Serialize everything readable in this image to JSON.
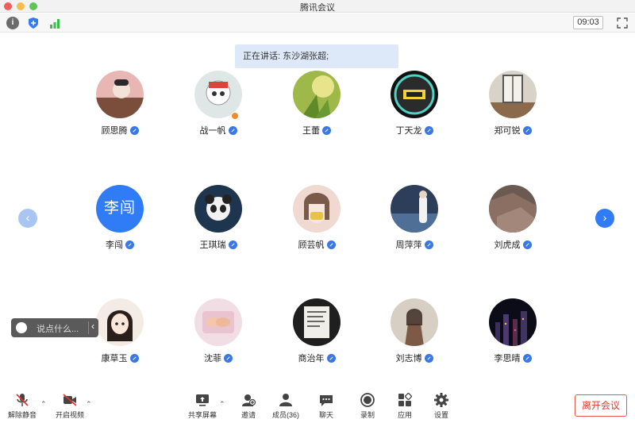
{
  "window": {
    "title": "腾讯会议"
  },
  "toolbar": {
    "time": "09:03"
  },
  "banner": {
    "speaking_text": "正在讲话: 东沙湖张超;"
  },
  "participants": [
    {
      "name": "顾思腾"
    },
    {
      "name": "战一帆",
      "host": true
    },
    {
      "name": "王蕾"
    },
    {
      "name": "丁天龙"
    },
    {
      "name": "郑可锐"
    },
    {
      "name": "李闯",
      "avatar_text": "李闯"
    },
    {
      "name": "王琪瑞"
    },
    {
      "name": "顾芸帆"
    },
    {
      "name": "周萍萍"
    },
    {
      "name": "刘虎成"
    },
    {
      "name": "康草玉"
    },
    {
      "name": "沈菲"
    },
    {
      "name": "商治年"
    },
    {
      "name": "刘志博"
    },
    {
      "name": "李思晴"
    }
  ],
  "chat": {
    "placeholder": "说点什么..."
  },
  "bottom": {
    "mute": "解除静音",
    "video": "开启视频",
    "share": "共享屏幕",
    "invite": "邀请",
    "members": "成员(36)",
    "chat": "聊天",
    "record": "录制",
    "apps": "应用",
    "settings": "设置",
    "leave": "离开会议"
  },
  "colors": {
    "accent": "#2f7cf6",
    "leave": "#e0392b",
    "banner": "#dde8f8"
  }
}
